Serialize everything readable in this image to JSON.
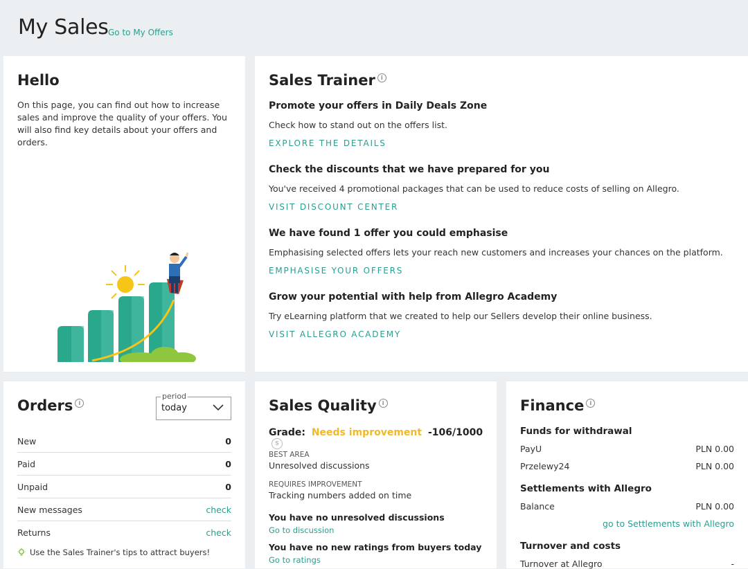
{
  "header": {
    "title": "My Sales",
    "offers_link": "Go to My Offers"
  },
  "hello": {
    "title": "Hello",
    "text": "On this page, you can find out how to increase sales and improve the quality of your offers. You will also find key details about your offers and orders."
  },
  "trainer": {
    "title": "Sales Trainer",
    "info": "i",
    "sections": [
      {
        "heading": "Promote your offers in Daily Deals Zone",
        "desc": "Check how to stand out on the offers list.",
        "link": "EXPLORE THE DETAILS"
      },
      {
        "heading": "Check the discounts that we have prepared for you",
        "desc": "You've received 4 promotional packages that can be used to reduce costs of selling on Allegro.",
        "link": "VISIT DISCOUNT CENTER"
      },
      {
        "heading": "We have found 1 offer you could emphasise",
        "desc": "Emphasising selected offers lets your reach new customers and increases your chances on the platform.",
        "link": "EMPHASISE YOUR OFFERS"
      },
      {
        "heading": "Grow your potential with help from Allegro Academy",
        "desc": "Try eLearning platform that we created to help our Sellers develop their online business.",
        "link": "VISIT ALLEGRO ACADEMY"
      }
    ]
  },
  "orders": {
    "title": "Orders",
    "info": "i",
    "period_label": "period",
    "period_value": "today",
    "rows": [
      {
        "label": "New",
        "value": "0"
      },
      {
        "label": "Paid",
        "value": "0"
      },
      {
        "label": "Unpaid",
        "value": "0"
      },
      {
        "label": "New messages",
        "link": "check"
      },
      {
        "label": "Returns",
        "link": "check"
      }
    ],
    "tip": "Use the Sales Trainer's tips to attract buyers!"
  },
  "quality": {
    "title": "Sales Quality",
    "info": "i",
    "grade_label": "Grade:",
    "grade_value": "Needs improvement",
    "grade_score": "-106/1000",
    "grade_badge": "S",
    "best_area_label": "BEST AREA",
    "best_area_value": "Unresolved discussions",
    "requires_label": "REQUIRES IMPROVEMENT",
    "requires_value": "Tracking numbers added on time",
    "discussions_text": "You have no unresolved discussions",
    "discussions_link": "Go to discussion",
    "ratings_text": "You have no new ratings from buyers today",
    "ratings_link": "Go to ratings"
  },
  "finance": {
    "title": "Finance",
    "info": "i",
    "funds_title": "Funds for withdrawal",
    "funds": [
      {
        "label": "PayU",
        "value": "PLN 0.00"
      },
      {
        "label": "Przelewy24",
        "value": "PLN 0.00"
      }
    ],
    "settlements_title": "Settlements with Allegro",
    "balance_label": "Balance",
    "balance_value": "PLN 0.00",
    "settlements_link": "go to Settlements with Allegro",
    "turnover_title": "Turnover and costs",
    "turnover_label": "Turnover at Allegro",
    "turnover_value": "-"
  },
  "colors": {
    "accent": "#2a9d8f",
    "warning": "#f0b92a",
    "background": "#eceff2"
  }
}
